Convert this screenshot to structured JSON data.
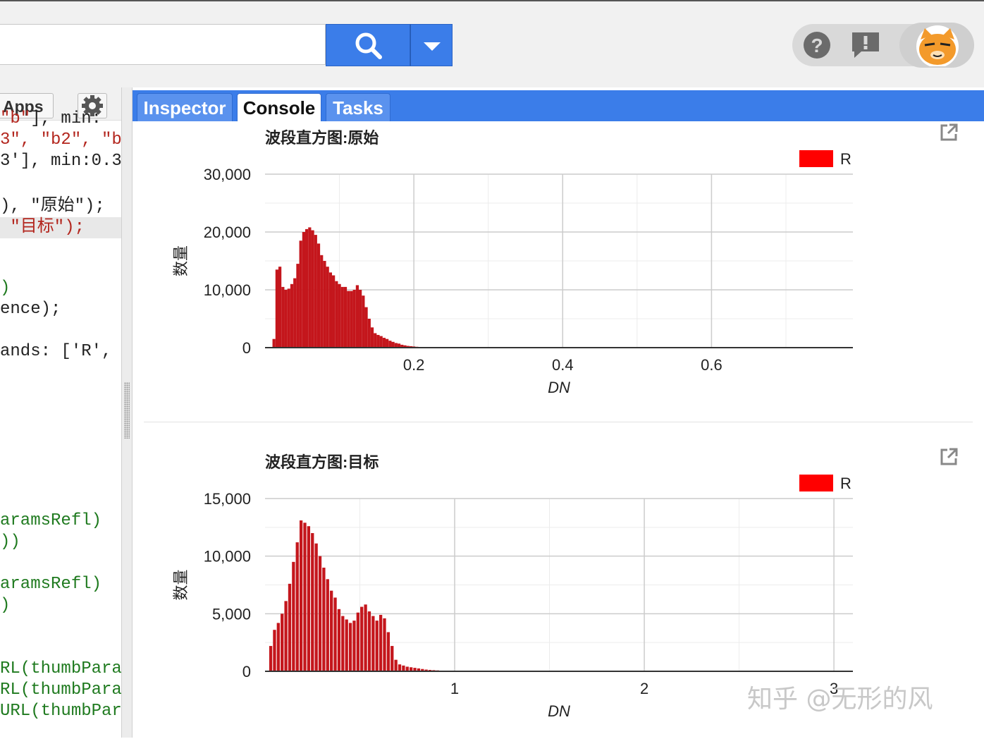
{
  "toolbar": {
    "search_value": "",
    "search_icon": "search-icon",
    "dropdown_icon": "caret-down-icon",
    "help_icon": "help-icon",
    "feedback_icon": "feedback-icon",
    "avatar": "user-avatar"
  },
  "left_panel": {
    "apps_label": "Apps",
    "settings_icon": "gear-icon",
    "code_lines": [
      {
        "t": "3\", \"b2\", \"b"
      },
      {
        "t": "3'], min:0.3"
      },
      {
        "t": "), \"原始\");"
      },
      {
        "t": " \"目标\");"
      },
      {
        "t": ")"
      },
      {
        "t": "ence);"
      },
      {
        "t": "ands: ['R',"
      },
      {
        "t": "aramsRefl)"
      },
      {
        "t": "))"
      },
      {
        "t": "aramsRefl)"
      },
      {
        "t": ")"
      },
      {
        "t": "RL(thumbPara"
      },
      {
        "t": "RL(thumbPara"
      },
      {
        "t": "URL(thumbPar"
      }
    ]
  },
  "tabs": [
    {
      "label": "Inspector",
      "active": false
    },
    {
      "label": "Console",
      "active": true
    },
    {
      "label": "Tasks",
      "active": false
    }
  ],
  "watermark": "知乎 @无形的风",
  "chart_data": [
    {
      "type": "bar",
      "title": "波段直方图:原始",
      "xlabel": "DN",
      "ylabel": "数量",
      "xlim": [
        0.0,
        0.79
      ],
      "ylim": [
        0,
        30000
      ],
      "x_ticks": [
        "0.2",
        "0.4",
        "0.6"
      ],
      "x_tick_values": [
        0.2,
        0.4,
        0.6
      ],
      "y_ticks": [
        "0",
        "10,000",
        "20,000",
        "30,000"
      ],
      "y_tick_values": [
        0,
        10000,
        20000,
        30000
      ],
      "legend": [
        "R"
      ],
      "legend_position": "top-right",
      "series_color": "#ff0000",
      "bar_color": "#c4161c",
      "bin_width": 0.004,
      "x": [
        0.012,
        0.016,
        0.02,
        0.024,
        0.028,
        0.032,
        0.036,
        0.04,
        0.044,
        0.048,
        0.052,
        0.056,
        0.06,
        0.064,
        0.068,
        0.072,
        0.076,
        0.08,
        0.084,
        0.088,
        0.092,
        0.096,
        0.1,
        0.104,
        0.108,
        0.112,
        0.116,
        0.12,
        0.124,
        0.128,
        0.132,
        0.136,
        0.14,
        0.144,
        0.148,
        0.152,
        0.156,
        0.16,
        0.164,
        0.168,
        0.172,
        0.176,
        0.18,
        0.184,
        0.188,
        0.192,
        0.196,
        0.2,
        0.204,
        0.208,
        0.212,
        0.216,
        0.22,
        0.224,
        0.228
      ],
      "values": [
        1500,
        13500,
        14000,
        10500,
        10000,
        10200,
        11000,
        12000,
        14500,
        18500,
        20000,
        20500,
        20800,
        20300,
        19500,
        18000,
        16000,
        15000,
        14000,
        13000,
        12500,
        11500,
        11000,
        10500,
        10500,
        9800,
        9800,
        10000,
        10800,
        10000,
        9000,
        7000,
        5000,
        3500,
        2500,
        2200,
        2000,
        1700,
        1500,
        1200,
        1000,
        800,
        700,
        500,
        400,
        300,
        250,
        200,
        150,
        120,
        100,
        80,
        60,
        40,
        20
      ]
    },
    {
      "type": "bar",
      "title": "波段直方图:目标",
      "xlabel": "DN",
      "ylabel": "数量",
      "xlim": [
        0.0,
        3.1
      ],
      "ylim": [
        0,
        15000
      ],
      "x_ticks": [
        "1",
        "2",
        "3"
      ],
      "x_tick_values": [
        1,
        2,
        3
      ],
      "y_ticks": [
        "0",
        "5,000",
        "10,000",
        "15,000"
      ],
      "y_tick_values": [
        0,
        5000,
        10000,
        15000
      ],
      "legend": [
        "R"
      ],
      "legend_position": "top-right",
      "series_color": "#ff0000",
      "bar_color": "#c4161c",
      "bin_width": 0.016,
      "x": [
        0.03,
        0.05,
        0.07,
        0.09,
        0.11,
        0.13,
        0.15,
        0.17,
        0.19,
        0.21,
        0.23,
        0.25,
        0.27,
        0.29,
        0.31,
        0.33,
        0.35,
        0.37,
        0.39,
        0.41,
        0.43,
        0.45,
        0.47,
        0.49,
        0.51,
        0.53,
        0.55,
        0.57,
        0.59,
        0.61,
        0.63,
        0.65,
        0.67,
        0.69,
        0.71,
        0.73,
        0.75,
        0.77,
        0.79,
        0.81,
        0.83,
        0.85,
        0.87,
        0.89,
        0.91,
        0.93,
        0.95,
        0.97,
        0.99,
        1.01,
        1.03,
        1.05,
        1.07,
        1.09,
        1.11,
        1.13,
        1.15,
        1.17
      ],
      "values": [
        2200,
        3600,
        4200,
        5000,
        6100,
        7600,
        9500,
        11200,
        13100,
        12900,
        12600,
        12000,
        11100,
        10000,
        9000,
        8000,
        7000,
        6400,
        5400,
        4800,
        4500,
        4200,
        4400,
        5100,
        5600,
        5800,
        5200,
        4800,
        4400,
        4900,
        4600,
        3400,
        2200,
        1000,
        600,
        500,
        400,
        350,
        300,
        250,
        200,
        150,
        120,
        100,
        80,
        60,
        40,
        30,
        20,
        15,
        10,
        10,
        5,
        5,
        5,
        5,
        5,
        5
      ]
    }
  ]
}
